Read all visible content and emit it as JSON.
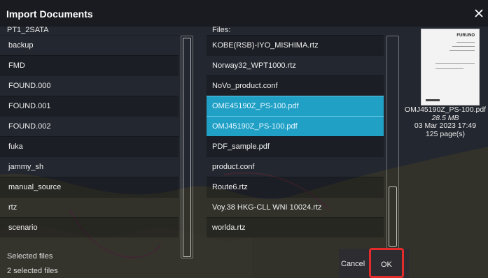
{
  "dialog": {
    "title": "Import Documents",
    "current_folder": "PT1_2SATA",
    "files_label": "Files:"
  },
  "folders": [
    {
      "label": "backup"
    },
    {
      "label": "FMD"
    },
    {
      "label": "FOUND.000"
    },
    {
      "label": "FOUND.001"
    },
    {
      "label": "FOUND.002"
    },
    {
      "label": "fuka"
    },
    {
      "label": "jammy_sh"
    },
    {
      "label": "manual_source"
    },
    {
      "label": "rtz"
    },
    {
      "label": "scenario"
    },
    {
      "label": "Selected files"
    }
  ],
  "files": [
    {
      "label": "KOBE(RSB)-IYO_MISHIMA.rtz",
      "selected": false
    },
    {
      "label": "Norway32_WPT1000.rtz",
      "selected": false
    },
    {
      "label": "NoVo_product.conf",
      "selected": false
    },
    {
      "label": "OME45190Z_PS-100.pdf",
      "selected": true
    },
    {
      "label": "OMJ45190Z_PS-100.pdf",
      "selected": true
    },
    {
      "label": "PDF_sample.pdf",
      "selected": false
    },
    {
      "label": "product.conf",
      "selected": false
    },
    {
      "label": "Route6.rtz",
      "selected": false
    },
    {
      "label": "Voy.38 HKG-CLL WNI 10024.rtz",
      "selected": false
    },
    {
      "label": "worlda.rtz",
      "selected": false
    }
  ],
  "preview": {
    "brand": "FURUNO",
    "filename": "OMJ45190Z_PS-100.pdf",
    "size": "28.5 MB",
    "date": "03 Mar 2023 17:49",
    "pages": "125 page(s)"
  },
  "footer": {
    "selected_count": "2 selected files",
    "cancel_label": "Cancel",
    "ok_label": "OK"
  },
  "colors": {
    "selection": "#21a0c6",
    "highlight_border": "#e42b2b"
  }
}
